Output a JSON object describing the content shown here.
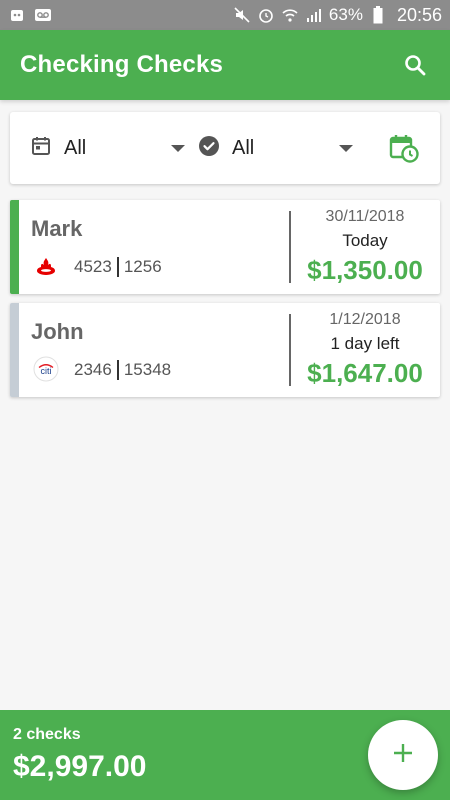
{
  "statusbar": {
    "battery": "63%",
    "time": "20:56",
    "left_icons": [
      "app-notification-icon",
      "voicemail-icon"
    ],
    "right_icons": [
      "mute-icon",
      "alarm-icon",
      "wifi-icon",
      "signal-icon",
      "battery-icon"
    ]
  },
  "appbar": {
    "title": "Checking Checks",
    "search_icon": "search-icon"
  },
  "filters": {
    "date_filter": {
      "icon": "calendar-icon",
      "value": "All"
    },
    "status_filter": {
      "icon": "check-circle-icon",
      "value": "All"
    },
    "schedule_icon": "calendar-clock-icon"
  },
  "checks": [
    {
      "name": "Mark",
      "bank": "santander-logo",
      "account": "4523",
      "check_no": "1256",
      "date": "30/11/2018",
      "due": "Today",
      "amount": "$1,350.00",
      "accent_color": "#4caf50"
    },
    {
      "name": "John",
      "bank": "citi-logo",
      "bank_text": "citi",
      "account": "2346",
      "check_no": "15348",
      "date": "1/12/2018",
      "due": "1 day left",
      "amount": "$1,647.00",
      "accent_color": "#c5cdd5"
    }
  ],
  "summary": {
    "count": "2 checks",
    "total": "$2,997.00"
  },
  "fab": {
    "icon": "plus-icon"
  },
  "colors": {
    "primary": "#4caf50",
    "background": "#f6f6f6",
    "statusbar": "#8c8c8c"
  }
}
